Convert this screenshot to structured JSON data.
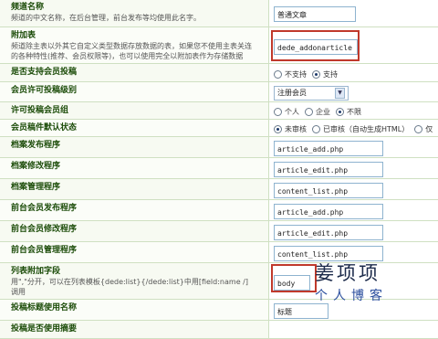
{
  "rows": [
    {
      "title": "频道名称",
      "desc": "频道的中文名称，在后台管理，前台发布等均使用此名字。",
      "input": "普通文章"
    },
    {
      "title": "附加表",
      "desc": "频道除主表以外其它自定义类型数据存放数据的表，如果您不使用主表关连",
      "desc2": "的各种特性(推荐、会员权限等)，也可以使用完全以附加表作为存储数据",
      "input": "dede_addonarticle"
    },
    {
      "title": "是否支持会员投稿",
      "radios": [
        {
          "label": "不支持",
          "checked": false
        },
        {
          "label": "支持",
          "checked": true
        }
      ]
    },
    {
      "title": "会员许可投稿级别",
      "select": "注册会员"
    },
    {
      "title": "许可投稿会员组",
      "radios": [
        {
          "label": "个人",
          "checked": false
        },
        {
          "label": "企业",
          "checked": false
        },
        {
          "label": "不限",
          "checked": true
        }
      ]
    },
    {
      "title": "会员稿件默认状态",
      "radios": [
        {
          "label": "未审核",
          "checked": true
        },
        {
          "label": "已审核（自动生成HTML）",
          "checked": false
        },
        {
          "label": "仅",
          "checked": false
        }
      ]
    },
    {
      "title": "档案发布程序",
      "input": "article_add.php"
    },
    {
      "title": "档案修改程序",
      "input": "article_edit.php"
    },
    {
      "title": "档案管理程序",
      "input": "content_list.php"
    },
    {
      "title": "前台会员发布程序",
      "input": "article_add.php"
    },
    {
      "title": "前台会员修改程序",
      "input": "article_edit.php"
    },
    {
      "title": "前台会员管理程序",
      "input": "content_list.php"
    },
    {
      "title": "列表附加字段",
      "desc": "用\",\"分开，可以在列表模板{dede:list}{/dede:list}中用[field:name /]",
      "desc2": "调用",
      "input": "body"
    },
    {
      "title": "投稿标题使用名称",
      "input": "标题"
    },
    {
      "title": "投稿是否使用摘要"
    }
  ],
  "watermark": {
    "line1": "姜项项",
    "line2": "个人博客"
  },
  "colors": {
    "title": "#1d4d0a",
    "border": "#cfe0c2",
    "highlight": "#c0392b"
  }
}
